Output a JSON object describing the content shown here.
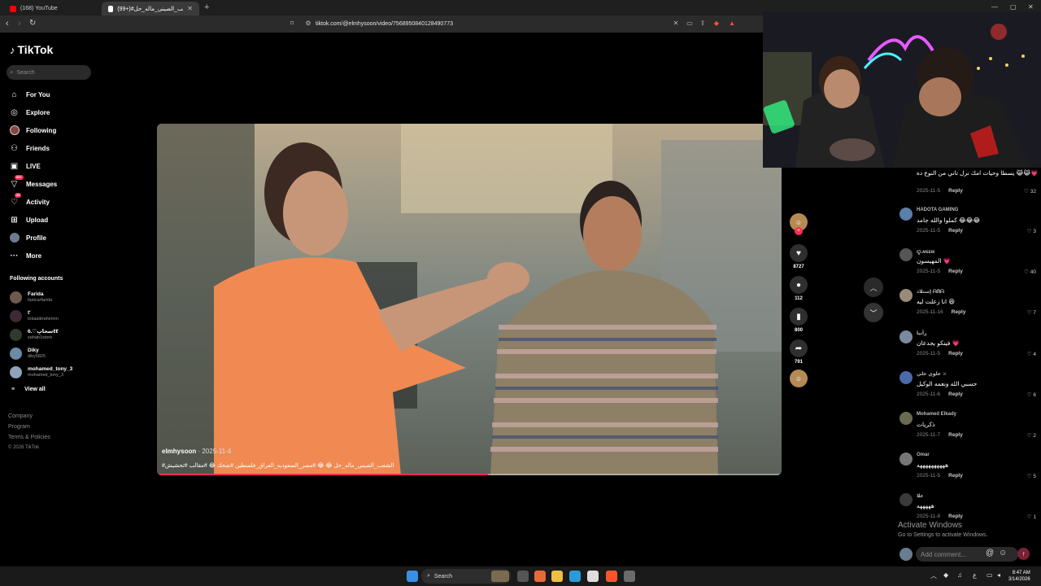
{
  "browser": {
    "tabs": [
      {
        "title": "(168) YouTube",
        "color": "#ff0000"
      },
      {
        "title": "(99+)#الشعب_الصيني_ماله_حل 😂",
        "color": "#ffffff"
      }
    ],
    "url": "tiktok.com/@elmhysoon/video/7568950840128490773"
  },
  "tiktok": {
    "logo": "TikTok",
    "search_placeholder": "Search",
    "nav": [
      {
        "label": "For You",
        "icon": "home-icon"
      },
      {
        "label": "Explore",
        "icon": "compass-icon"
      },
      {
        "label": "Following",
        "icon": "following-icon"
      },
      {
        "label": "Friends",
        "icon": "friends-icon"
      },
      {
        "label": "LIVE",
        "icon": "live-icon"
      },
      {
        "label": "Messages",
        "icon": "messages-icon",
        "badge": "99+"
      },
      {
        "label": "Activity",
        "icon": "activity-icon",
        "badge": "39"
      },
      {
        "label": "Upload",
        "icon": "upload-icon"
      },
      {
        "label": "Profile",
        "icon": "profile-icon"
      },
      {
        "label": "More",
        "icon": "more-icon"
      }
    ],
    "following_title": "Following accounts",
    "accounts": [
      {
        "name": "Farida",
        "user": "fastcarfarida"
      },
      {
        "name": "t'",
        "user": "tokaaibrahemm"
      },
      {
        "name": "سحابِ♡.6ℓℓ",
        "user": "sahab1store"
      },
      {
        "name": "Diky",
        "user": "diky5825"
      },
      {
        "name": "mohamed_tony_3",
        "user": "mohamed_tony_3"
      }
    ],
    "view_all": "View all",
    "footer": [
      "Company",
      "Program",
      "Terms & Policies",
      "© 2026 TikTok"
    ]
  },
  "video": {
    "author": "elmhysoon",
    "date": "· 2025-11-4",
    "caption": "#الشعب_الصيني_ماله_حل 😂 😂 #مصر_السعوديه_العراق_فلسطين #ضحك 😂 #مقالب #تحشيش",
    "progress": 0.53
  },
  "actions": {
    "likes": "8727",
    "comments": "112",
    "saves": "800",
    "shares": "791"
  },
  "comments": [
    {
      "name": "",
      "text": "يسطا وحيات امك نزل تاني من النوع ده 😹😹💗",
      "date": "2025-11-5",
      "likes": "32"
    },
    {
      "name": "HADOTA GAMING",
      "text": "كملوا والله جامد 😂😂😂",
      "date": "2025-11-5",
      "likes": "3"
    },
    {
      "name": "ꨄ.ᴍᴇᴇᴍ",
      "text": "المهيسون 💗",
      "date": "2025-11-5",
      "likes": "40"
    },
    {
      "name": "إستلاذ ᗩᗰᗩ",
      "text": "انا زعلت ليه 😆",
      "date": "2025-11-16",
      "likes": "7"
    },
    {
      "name": "ڔاَنيا",
      "text": "فينكو يجدعان 💗",
      "date": "2025-11-5",
      "likes": "4"
    },
    {
      "name": "علوي علي ⚔",
      "text": "حسبي الله ونعمه الوكيل",
      "date": "2025-11-6",
      "likes": "6"
    },
    {
      "name": "Mohamed Elkady",
      "text": "ذكريات",
      "date": "2025-11-7",
      "likes": "2"
    },
    {
      "name": "Omar",
      "text": "ههههههههههه",
      "date": "2025-11-5",
      "likes": "5"
    },
    {
      "name": "علا",
      "text": "هههههه",
      "date": "2025-11-8",
      "likes": "1"
    }
  ],
  "reply_label": "Reply",
  "add_comment_placeholder": "Add comment...",
  "activate": {
    "title": "Activate Windows",
    "sub": "Go to Settings to activate Windows."
  },
  "taskbar": {
    "search": "Search",
    "time": "8:47 AM",
    "date": "3/14/2026"
  }
}
